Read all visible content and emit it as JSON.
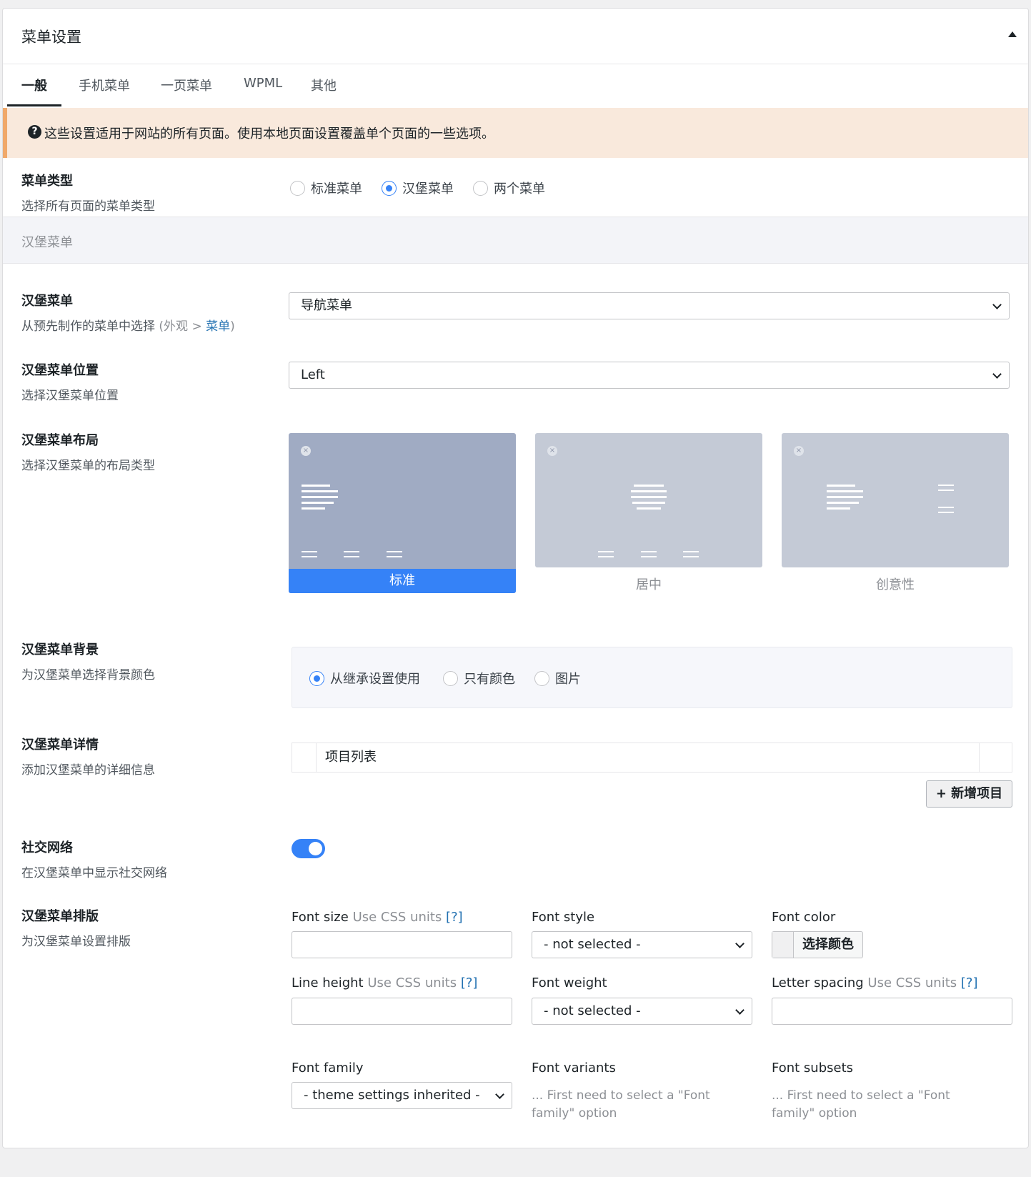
{
  "panel": {
    "title": "菜单设置"
  },
  "tabs": [
    {
      "label": "一般",
      "active": true
    },
    {
      "label": "手机菜单"
    },
    {
      "label": "一页菜单"
    },
    {
      "label": "WPML"
    },
    {
      "label": "其他"
    }
  ],
  "notice": {
    "icon": "help-icon",
    "text": "这些设置适用于网站的所有页面。使用本地页面设置覆盖单个页面的一些选项。"
  },
  "menu_type": {
    "title": "菜单类型",
    "desc": "选择所有页面的菜单类型",
    "options": [
      "标准菜单",
      "汉堡菜单",
      "两个菜单"
    ],
    "selected": "汉堡菜单"
  },
  "section": {
    "title": "汉堡菜单"
  },
  "hamburger_menu": {
    "title": "汉堡菜单",
    "desc_prefix": "从预先制作的菜单中选择 ",
    "desc_open": "(外观 > ",
    "desc_link": "菜单",
    "desc_close": ")",
    "value": "导航菜单"
  },
  "hamburger_position": {
    "title": "汉堡菜单位置",
    "desc": "选择汉堡菜单位置",
    "value": "Left"
  },
  "hamburger_layout": {
    "title": "汉堡菜单布局",
    "desc": "选择汉堡菜单的布局类型",
    "options": [
      "标准",
      "居中",
      "创意性"
    ],
    "selected": "标准",
    "close_glyph": "×"
  },
  "hamburger_background": {
    "title": "汉堡菜单背景",
    "desc": "为汉堡菜单选择背景颜色",
    "options": [
      "从继承设置使用",
      "只有颜色",
      "图片"
    ],
    "selected": "从继承设置使用"
  },
  "hamburger_details": {
    "title": "汉堡菜单详情",
    "desc": "添加汉堡菜单的详细信息",
    "list_label": "项目列表",
    "add_button": "+ 新增项目"
  },
  "social": {
    "title": "社交网络",
    "desc": "在汉堡菜单中显示社交网络",
    "enabled": true
  },
  "typography": {
    "title": "汉堡菜单排版",
    "desc": "为汉堡菜单设置排版",
    "font_size": {
      "label": "Font size",
      "hint": "Use CSS units",
      "help": "[?]",
      "value": ""
    },
    "font_style": {
      "label": "Font style",
      "value": "- not selected -"
    },
    "font_color": {
      "label": "Font color",
      "button": "选择颜色"
    },
    "line_height": {
      "label": "Line height",
      "hint": "Use CSS units",
      "help": "[?]",
      "value": ""
    },
    "font_weight": {
      "label": "Font weight",
      "value": "- not selected -"
    },
    "letter_spacing": {
      "label": "Letter spacing",
      "hint": "Use CSS units",
      "help": "[?]",
      "value": ""
    },
    "font_family": {
      "label": "Font family",
      "value": "- theme settings inherited -"
    },
    "font_variants": {
      "label": "Font variants",
      "note": "... First need to select a \"Font family\" option"
    },
    "font_subsets": {
      "label": "Font subsets",
      "note": "... First need to select a \"Font family\" option"
    }
  },
  "colors": {
    "accent": "#3582f7",
    "notice_bg": "#f9e9dc",
    "notice_border": "#f0a96b"
  }
}
